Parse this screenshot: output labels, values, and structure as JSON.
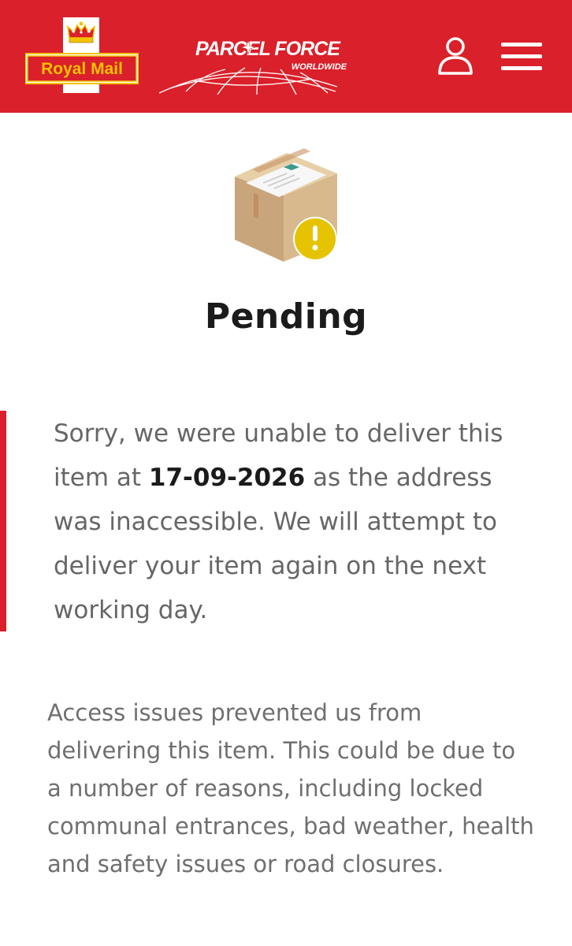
{
  "header": {
    "royal_mail_logo_text": "Royal Mail",
    "parcelforce_logo_text": "PARCEL FORCE",
    "parcelforce_logo_subtext": "WORLDWIDE",
    "user_icon": "user-icon",
    "menu_icon": "hamburger-menu-icon",
    "background_color": "#da202a"
  },
  "status": {
    "icon": "parcel-box-with-warning-icon",
    "title": "Pending",
    "badge_color": "#e5c300"
  },
  "message": {
    "part1": "Sorry, we were unable to deliver this item at ",
    "date": "17-09-2026",
    "part2": " as the address was inaccessible. We will attempt to deliver your item again on the next working day."
  },
  "detail": {
    "text": "Access issues prevented us from delivering this item. This could be due to a number of reasons, including locked communal entrances, bad weather, health and safety issues or road closures."
  }
}
